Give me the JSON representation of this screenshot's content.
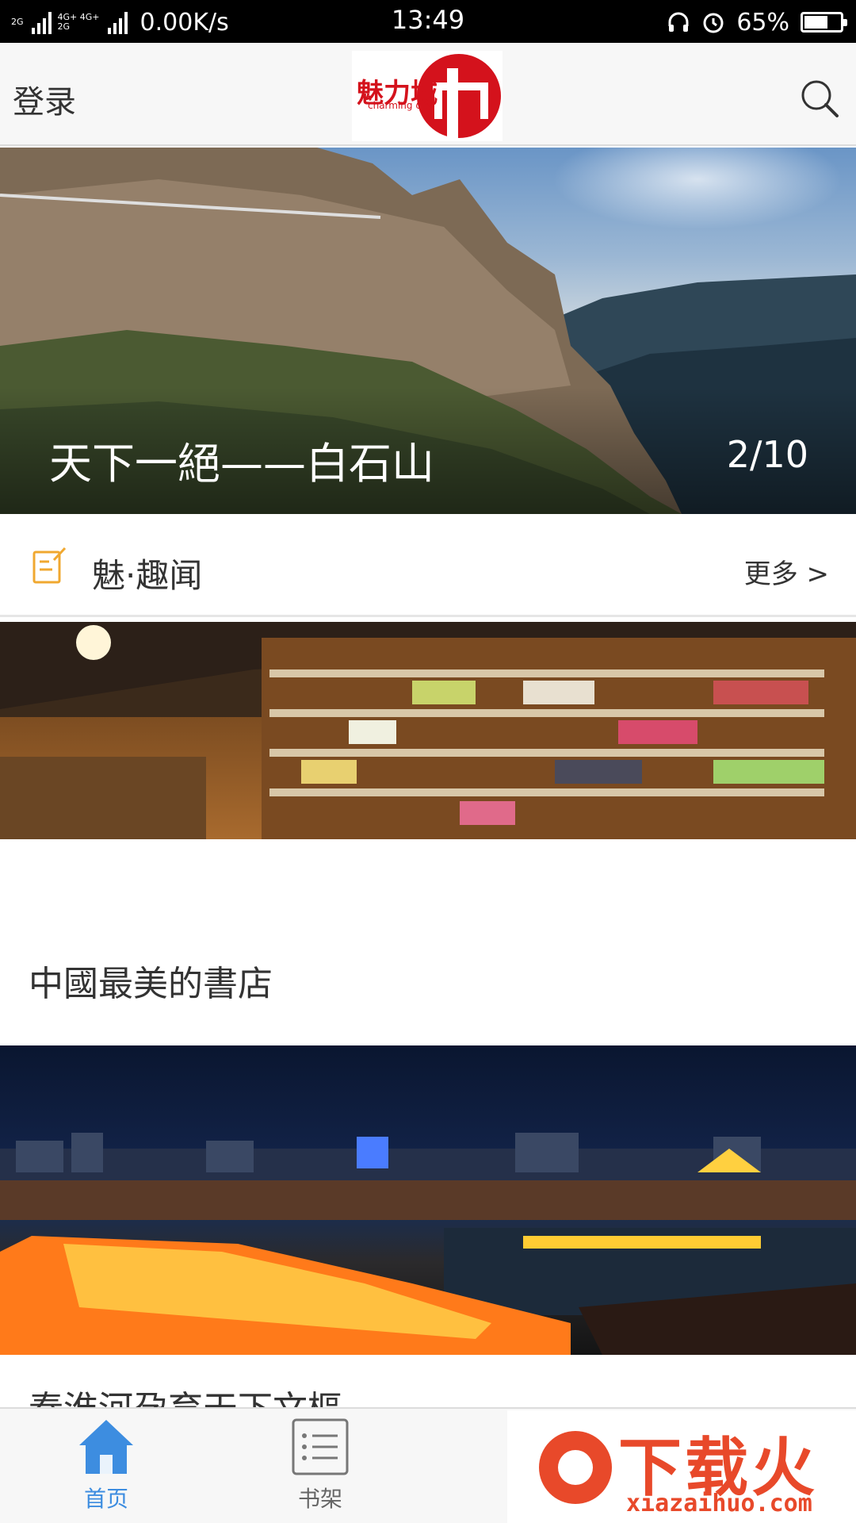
{
  "status_bar": {
    "network_labels": [
      "2G",
      "4G+ 4G+",
      "2G"
    ],
    "speed": "0.00K/s",
    "time": "13:49",
    "battery_text": "65%",
    "battery_level": 0.65,
    "icons": [
      "signal-icon",
      "headset-icon",
      "alarm-icon",
      "battery-icon"
    ]
  },
  "header": {
    "login_label": "登录",
    "logo": {
      "text": "魅力城",
      "subtext": "charming city"
    },
    "brand_color": "#d4121c",
    "search_icon": "search-icon"
  },
  "banner": {
    "title": "天下一絕——白石山",
    "counter": "2/10"
  },
  "section": {
    "icon": "edit-note-icon",
    "title": "魅·趣闻",
    "more_label": "更多 >"
  },
  "articles": [
    {
      "title": "中國最美的書店",
      "image": "bookstore-photo"
    },
    {
      "title": "秦淮河孕育天下文樞",
      "image": "night-river-photo"
    }
  ],
  "bottom_nav": {
    "items": [
      {
        "label": "首页",
        "icon": "home-icon",
        "active": true
      },
      {
        "label": "书架",
        "icon": "list-icon",
        "active": false
      }
    ],
    "active_color": "#3d8de0"
  },
  "watermark": {
    "text": "下载火",
    "url": "xiazaihuo.com",
    "color": "#e8492a"
  }
}
